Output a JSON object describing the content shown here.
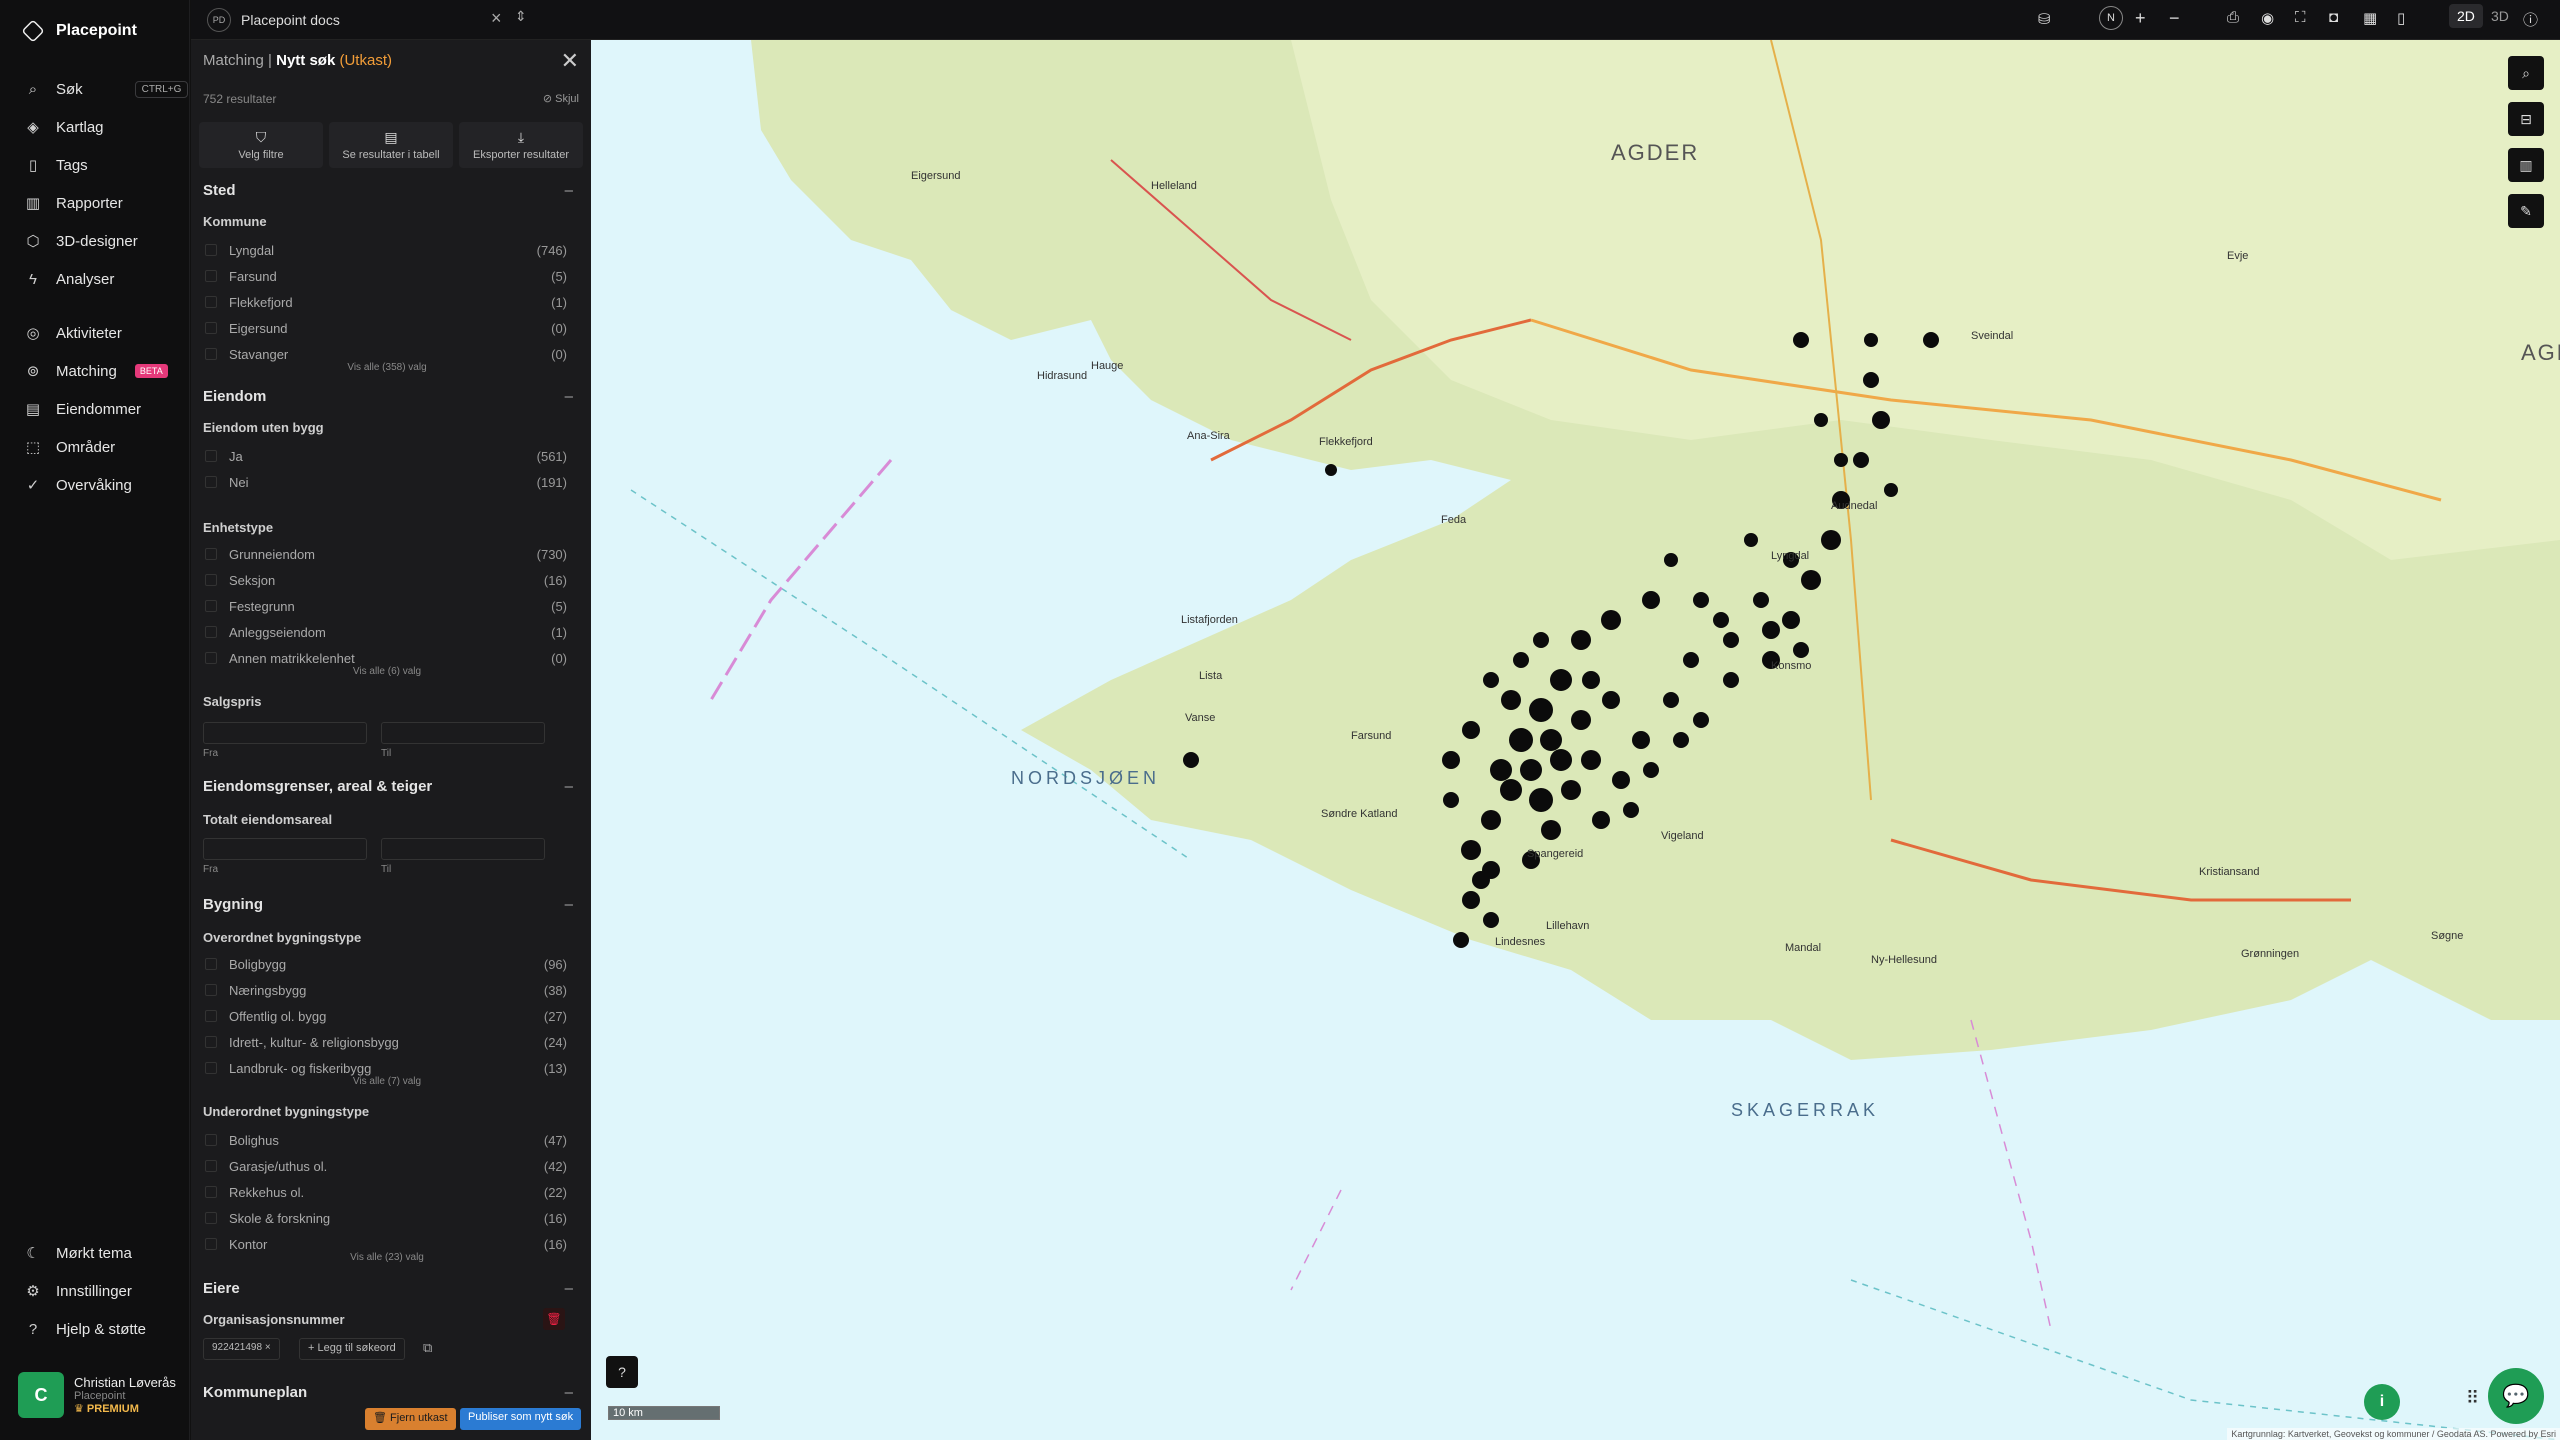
{
  "app": {
    "name": "Placepoint",
    "workspace": "Placepoint docs",
    "workspace_initials": "PD"
  },
  "nav": {
    "items": [
      {
        "label": "Søk",
        "icon": "search-icon",
        "shortcut": "CTRL+G"
      },
      {
        "label": "Kartlag",
        "icon": "layers-icon"
      },
      {
        "label": "Tags",
        "icon": "bookmark-icon"
      },
      {
        "label": "Rapporter",
        "icon": "chart-icon"
      },
      {
        "label": "3D-designer",
        "icon": "cube-icon"
      },
      {
        "label": "Analyser",
        "icon": "bolt-icon"
      },
      {
        "label": "Aktiviteter",
        "icon": "activity-icon"
      },
      {
        "label": "Matching",
        "icon": "target-icon",
        "badge": "BETA"
      },
      {
        "label": "Eiendommer",
        "icon": "building-icon"
      },
      {
        "label": "Områder",
        "icon": "area-icon"
      },
      {
        "label": "Overvåking",
        "icon": "check-circle-icon"
      }
    ],
    "bottom": [
      {
        "label": "Mørkt tema",
        "icon": "moon-icon"
      },
      {
        "label": "Innstillinger",
        "icon": "gear-icon"
      },
      {
        "label": "Hjelp & støtte",
        "icon": "help-icon"
      }
    ],
    "user": {
      "initial": "C",
      "name": "Christian Løverås",
      "org": "Placepoint",
      "tier": "PREMIUM"
    }
  },
  "panel": {
    "crumb": "Matching",
    "title": "Nytt søk",
    "status": "(Utkast)",
    "results": "752 resultater",
    "hide": "Skjul",
    "actions": [
      "Velg filtre",
      "Se resultater i tabell",
      "Eksporter resultater"
    ],
    "sted": {
      "title": "Sted",
      "kommune_label": "Kommune",
      "kommune": [
        {
          "label": "Lyngdal",
          "count": "(746)"
        },
        {
          "label": "Farsund",
          "count": "(5)"
        },
        {
          "label": "Flekkefjord",
          "count": "(1)"
        },
        {
          "label": "Eigersund",
          "count": "(0)"
        },
        {
          "label": "Stavanger",
          "count": "(0)"
        }
      ],
      "kommune_more": "Vis alle (358) valg"
    },
    "eiendom": {
      "title": "Eiendom",
      "uten_label": "Eiendom uten bygg",
      "uten": [
        {
          "label": "Ja",
          "count": "(561)"
        },
        {
          "label": "Nei",
          "count": "(191)"
        }
      ],
      "enhet_label": "Enhetstype",
      "enhet": [
        {
          "label": "Grunneiendom",
          "count": "(730)"
        },
        {
          "label": "Seksjon",
          "count": "(16)"
        },
        {
          "label": "Festegrunn",
          "count": "(5)"
        },
        {
          "label": "Anleggseiendom",
          "count": "(1)"
        },
        {
          "label": "Annen matrikkelenhet",
          "count": "(0)"
        }
      ],
      "enhet_more": "Vis alle (6) valg",
      "salgspris_label": "Salgspris",
      "from": "Fra",
      "to": "Til"
    },
    "grenser": {
      "title": "Eiendomsgrenser, areal & teiger",
      "areal_label": "Totalt eiendomsareal",
      "from": "Fra",
      "to": "Til"
    },
    "bygning": {
      "title": "Bygning",
      "over_label": "Overordnet bygningstype",
      "over": [
        {
          "label": "Boligbygg",
          "count": "(96)"
        },
        {
          "label": "Næringsbygg",
          "count": "(38)"
        },
        {
          "label": "Offentlig ol. bygg",
          "count": "(27)"
        },
        {
          "label": "Idrett-, kultur- & religionsbygg",
          "count": "(24)"
        },
        {
          "label": "Landbruk- og fiskeribygg",
          "count": "(13)"
        }
      ],
      "over_more": "Vis alle (7) valg",
      "under_label": "Underordnet bygningstype",
      "under": [
        {
          "label": "Bolighus",
          "count": "(47)"
        },
        {
          "label": "Garasje/uthus ol.",
          "count": "(42)"
        },
        {
          "label": "Rekkehus ol.",
          "count": "(22)"
        },
        {
          "label": "Skole & forskning",
          "count": "(16)"
        },
        {
          "label": "Kontor",
          "count": "(16)"
        }
      ],
      "under_more": "Vis alle (23) valg"
    },
    "eiere": {
      "title": "Eiere",
      "org_label": "Organisasjonsnummer",
      "chip": "922421498",
      "add": "Legg til søkeord"
    },
    "kommuneplan": {
      "title": "Kommuneplan"
    },
    "buttons": {
      "remove": "Fjern utkast",
      "publish": "Publiser som nytt søk"
    }
  },
  "map": {
    "mode_2d": "2D",
    "mode_3d": "3D",
    "compass": "N",
    "scale": "10 km",
    "seas": [
      "NORDSJØEN",
      "SKAGERRAK"
    ],
    "regions": [
      "AGDER",
      "AGDER"
    ],
    "places": [
      "Flekkefjord",
      "Feda",
      "Lyngdal",
      "Farsund",
      "Lista",
      "Vanse",
      "Spangereid",
      "Lindesnes",
      "Mandal",
      "Kristiansand",
      "Vigeland",
      "Evje",
      "Sveindal",
      "Konsmo",
      "Hidrasund",
      "Søndre Katland",
      "Listafjorden",
      "Hauge",
      "Ana-Sira",
      "Eigersund",
      "Helleland",
      "Søgne",
      "Grønningen",
      "Ny-Hellesund",
      "Lillehavn",
      "Audnedal"
    ],
    "attribution": "Kartgrunnlag: Kartverket, Geovekst og kommuner / Geodata AS. Powered by Esri",
    "info": "i"
  }
}
